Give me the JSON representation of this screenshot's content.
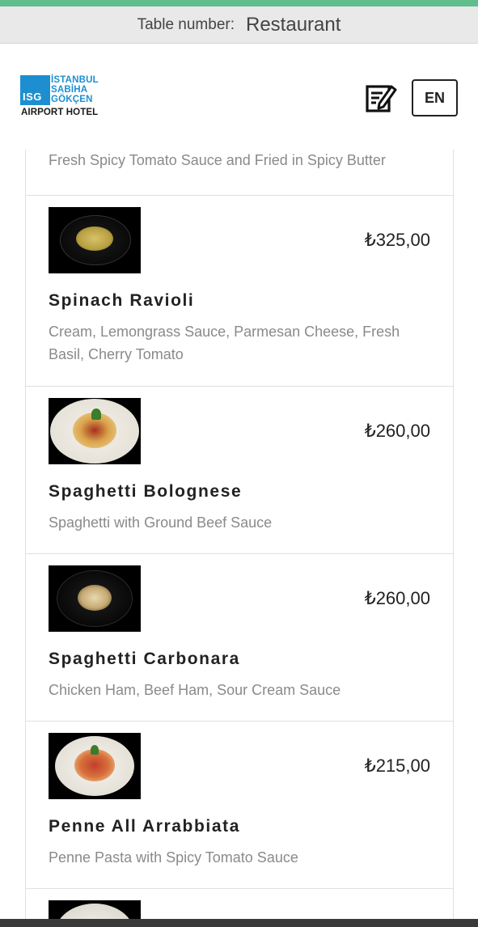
{
  "table_bar": {
    "label": "Table number:",
    "value": "Restaurant"
  },
  "logo": {
    "box_text": "ISG",
    "lines": [
      "İSTANBUL",
      "SABİHA",
      "GÖKÇEN"
    ],
    "bottom": "AIRPORT HOTEL"
  },
  "header": {
    "edit_icon": "edit-note-icon",
    "language": "EN"
  },
  "colors": {
    "accent": "#5fbe8c",
    "brand_blue": "#1d8fd0"
  },
  "menu": {
    "partial_description": "Fresh Spicy Tomato Sauce and Fried in Spicy Butter",
    "items": [
      {
        "name": "Spinach Ravioli",
        "price": "₺325,00",
        "description": "Cream, Lemongrass Sauce, Parmesan Cheese, Fresh Basil, Cherry Tomato"
      },
      {
        "name": "Spaghetti Bolognese",
        "price": "₺260,00",
        "description": "Spaghetti with Ground Beef Sauce"
      },
      {
        "name": "Spaghetti Carbonara",
        "price": "₺260,00",
        "description": "Chicken Ham, Beef Ham, Sour Cream Sauce"
      },
      {
        "name": "Penne All Arrabbiata",
        "price": "₺215,00",
        "description": "Penne Pasta with Spicy Tomato Sauce"
      }
    ]
  }
}
